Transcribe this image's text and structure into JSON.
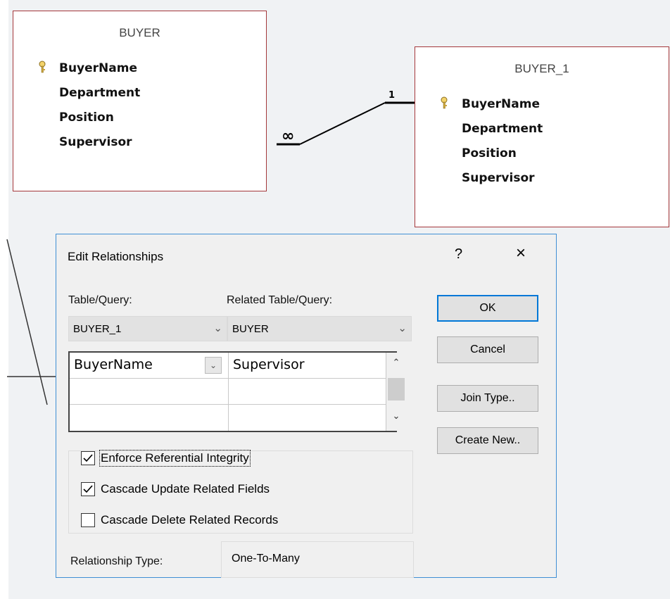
{
  "tables": {
    "buyer": {
      "title": "BUYER",
      "fields": [
        "BuyerName",
        "Department",
        "Position",
        "Supervisor"
      ],
      "key_field": "BuyerName"
    },
    "buyer_1": {
      "title": "BUYER_1",
      "fields": [
        "BuyerName",
        "Department",
        "Position",
        "Supervisor"
      ],
      "key_field": "BuyerName"
    }
  },
  "relationship": {
    "one_label": "1",
    "many_label": "∞"
  },
  "dialog": {
    "title": "Edit Relationships",
    "help_label": "?",
    "close_label": "×",
    "table_query_label": "Table/Query:",
    "related_table_query_label": "Related Table/Query:",
    "table_query_value": "BUYER_1",
    "related_table_query_value": "BUYER",
    "grid_rows": [
      {
        "left": "BuyerName",
        "right": "Supervisor"
      },
      {
        "left": "",
        "right": ""
      },
      {
        "left": "",
        "right": ""
      }
    ],
    "options": [
      {
        "label": "Enforce Referential Integrity",
        "checked": true
      },
      {
        "label": "Cascade Update Related Fields",
        "checked": true
      },
      {
        "label": "Cascade Delete Related Records",
        "checked": false
      }
    ],
    "relationship_type_label": "Relationship Type:",
    "relationship_type_value": "One-To-Many",
    "buttons": {
      "ok": "OK",
      "cancel": "Cancel",
      "join_type": "Join Type..",
      "create_new": "Create New.."
    }
  },
  "colors": {
    "table_border": "#a4373a",
    "dialog_border": "#3f8fd4",
    "default_button_border": "#0078d7",
    "canvas_background": "#f0f2f4"
  }
}
